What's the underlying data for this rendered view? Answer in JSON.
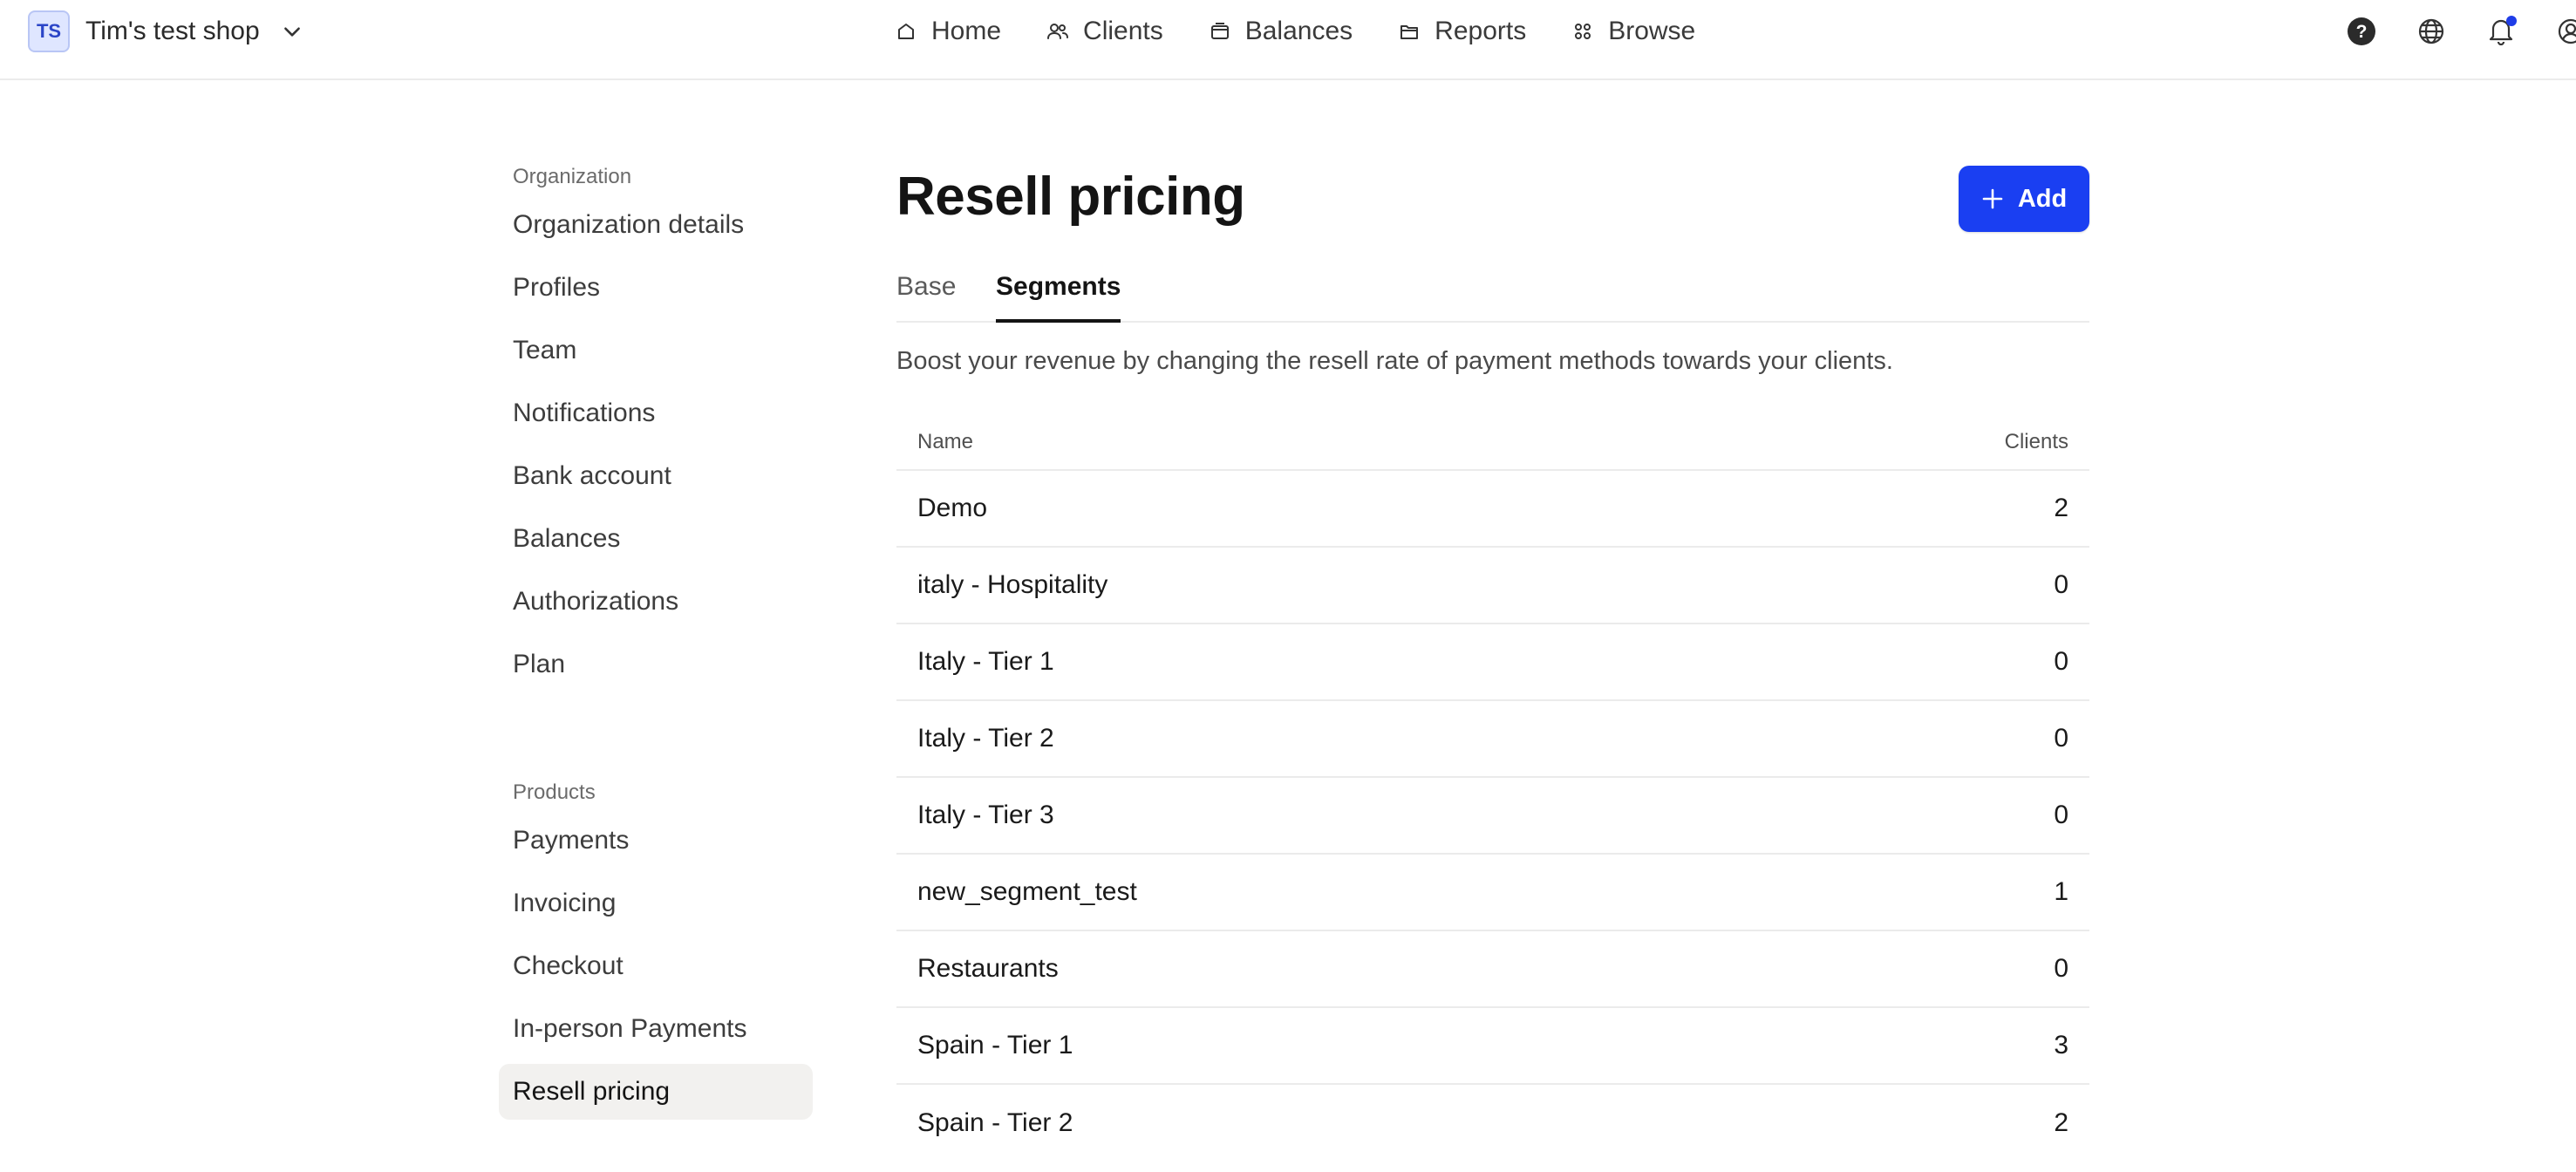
{
  "header": {
    "org_initials": "TS",
    "org_name": "Tim's test shop",
    "nav": [
      {
        "label": "Home",
        "icon": "home-icon"
      },
      {
        "label": "Clients",
        "icon": "users-icon"
      },
      {
        "label": "Balances",
        "icon": "wallet-icon"
      },
      {
        "label": "Reports",
        "icon": "folder-icon"
      },
      {
        "label": "Browse",
        "icon": "grid-icon"
      }
    ],
    "utilities": [
      "help-icon",
      "globe-icon",
      "bell-icon",
      "account-icon"
    ],
    "notification_dot_color": "#1f3de8"
  },
  "sidebar": {
    "organization": {
      "heading": "Organization",
      "items": [
        "Organization details",
        "Profiles",
        "Team",
        "Notifications",
        "Bank account",
        "Balances",
        "Authorizations",
        "Plan"
      ]
    },
    "products": {
      "heading": "Products",
      "items": [
        "Payments",
        "Invoicing",
        "Checkout",
        "In-person Payments",
        "Resell pricing"
      ]
    },
    "active": "Resell pricing"
  },
  "main": {
    "title": "Resell pricing",
    "add_label": "Add",
    "tabs": [
      "Base",
      "Segments"
    ],
    "active_tab": "Segments",
    "description": "Boost your revenue by changing the resell rate of payment methods towards your clients.",
    "table": {
      "headers": {
        "name": "Name",
        "clients": "Clients"
      },
      "rows": [
        {
          "name": "Demo",
          "clients": "2"
        },
        {
          "name": "italy - Hospitality",
          "clients": "0"
        },
        {
          "name": "Italy - Tier 1",
          "clients": "0"
        },
        {
          "name": "Italy - Tier 2",
          "clients": "0"
        },
        {
          "name": "Italy - Tier 3",
          "clients": "0"
        },
        {
          "name": "new_segment_test",
          "clients": "1"
        },
        {
          "name": "Restaurants",
          "clients": "0"
        },
        {
          "name": "Spain - Tier 1",
          "clients": "3"
        },
        {
          "name": "Spain - Tier 2",
          "clients": "2"
        }
      ]
    }
  },
  "colors": {
    "accent": "#1a3ff2",
    "active_sidebar_bg": "#f2f1ef",
    "divider": "#ebebeb"
  }
}
